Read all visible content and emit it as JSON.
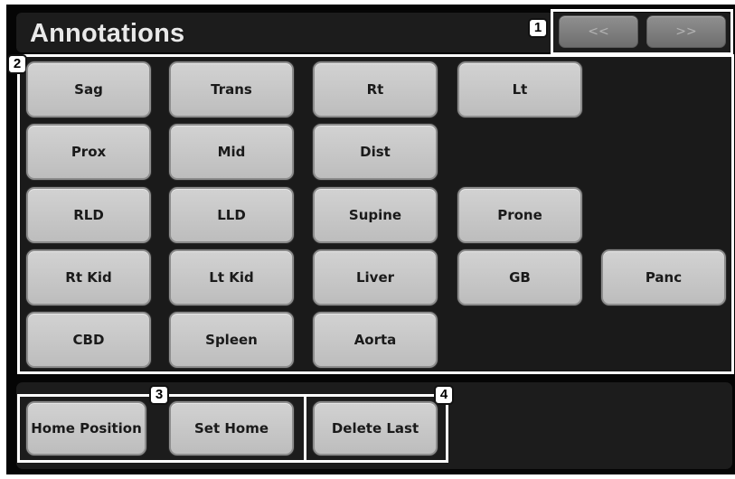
{
  "header": {
    "title": "Annotations",
    "prev_label": "<<",
    "next_label": ">>"
  },
  "callouts": [
    "1",
    "2",
    "3",
    "4"
  ],
  "annotations": {
    "row1": [
      "Sag",
      "Trans",
      "Rt",
      "Lt"
    ],
    "row2": [
      "Prox",
      "Mid",
      "Dist"
    ],
    "row3": [
      "RLD",
      "LLD",
      "Supine",
      "Prone"
    ],
    "row4": [
      "Rt Kid",
      "Lt Kid",
      "Liver",
      "GB",
      "Panc"
    ],
    "row5": [
      "CBD",
      "Spleen",
      "Aorta"
    ]
  },
  "bottom": {
    "home_position": "Home Position",
    "set_home": "Set Home",
    "delete_last": "Delete Last"
  }
}
